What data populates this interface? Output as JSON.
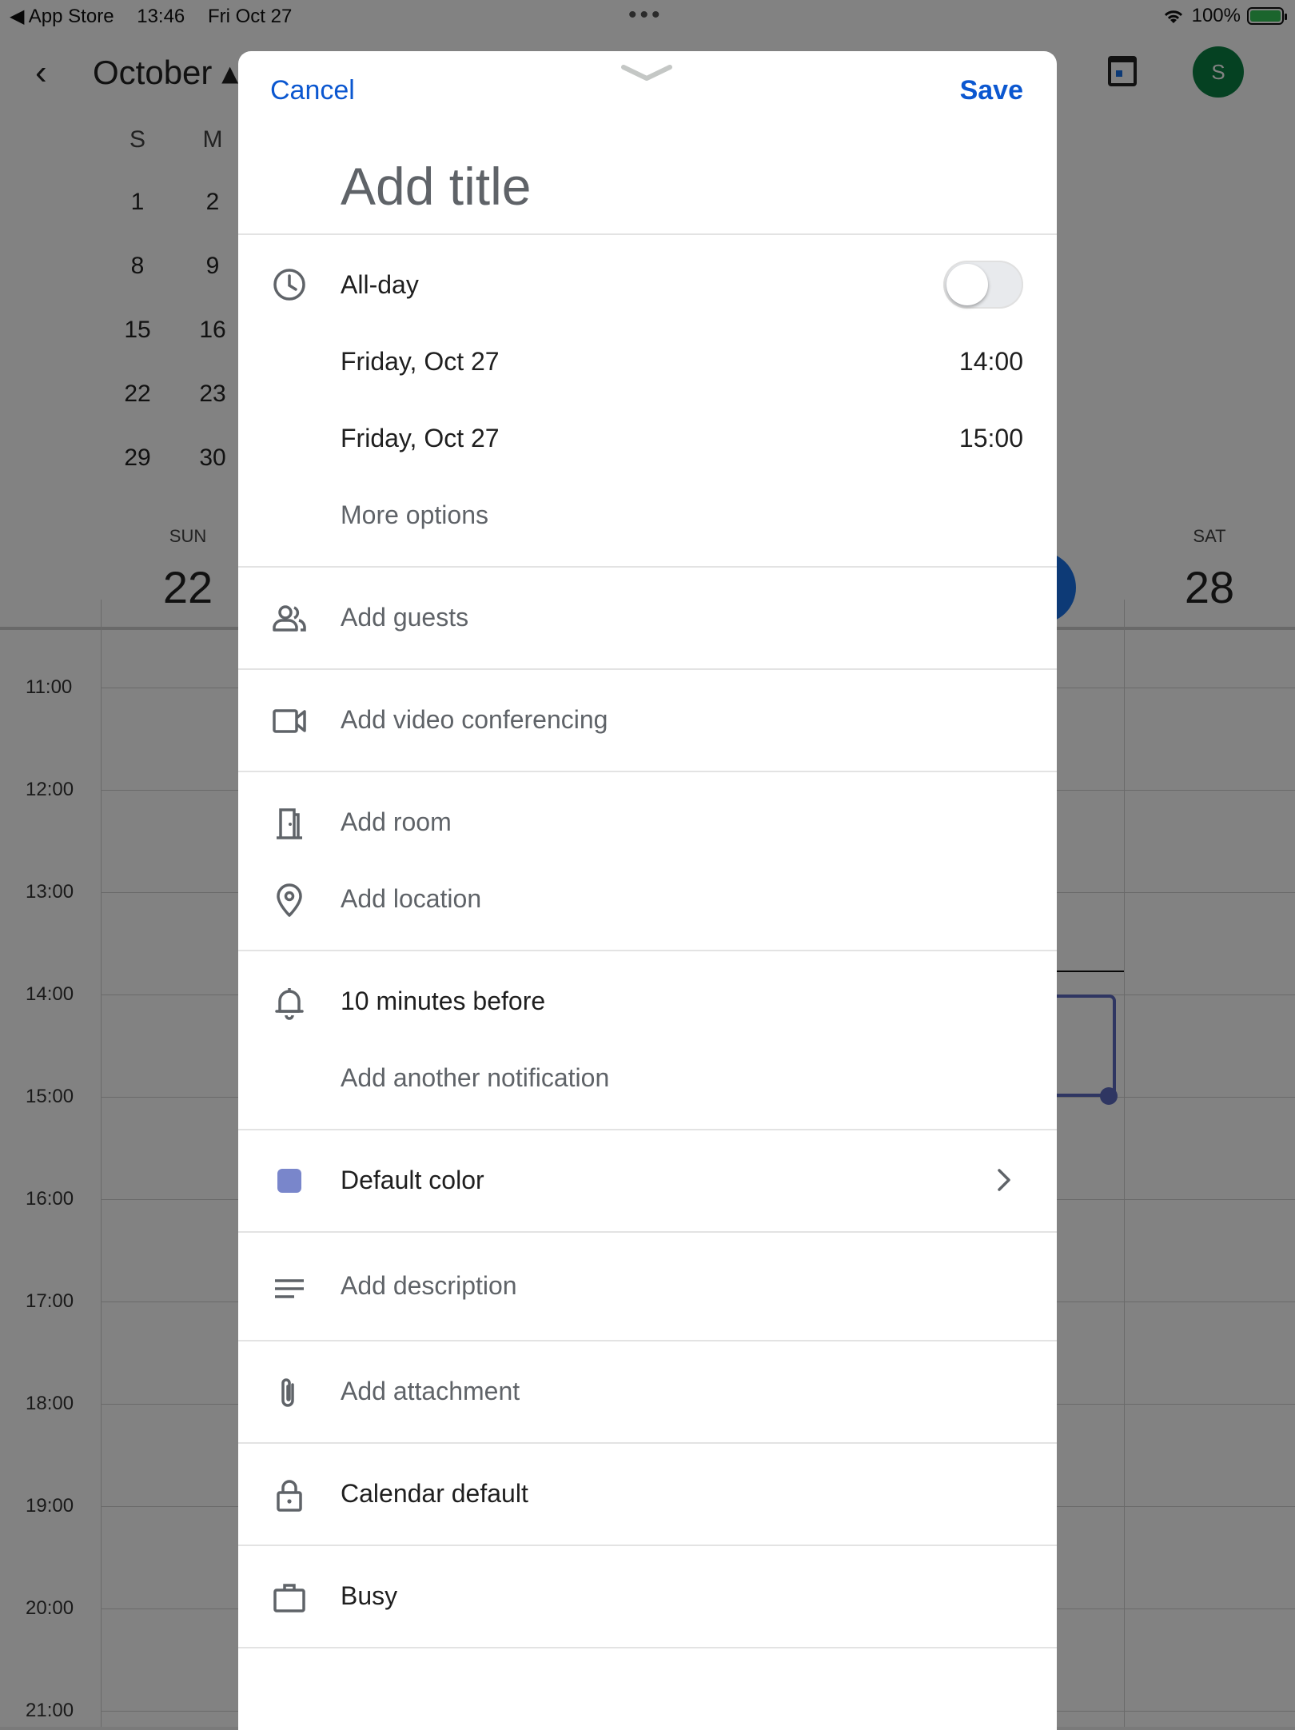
{
  "status_bar": {
    "back_app": "◀ App Store",
    "time": "13:46",
    "date": "Fri Oct 27",
    "battery": "100%"
  },
  "calendar_bg": {
    "month": "October",
    "avatar_initial": "S",
    "mini_cal_dow": [
      "S",
      "M"
    ],
    "mini_cal_rows": [
      [
        "1",
        "2"
      ],
      [
        "8",
        "9"
      ],
      [
        "15",
        "16"
      ],
      [
        "22",
        "23"
      ],
      [
        "29",
        "30"
      ]
    ],
    "week": [
      {
        "dow": "SUN",
        "day": "22"
      },
      {
        "dow": "SAT",
        "day": "28"
      }
    ],
    "hours": [
      "11:00",
      "12:00",
      "13:00",
      "14:00",
      "15:00",
      "16:00",
      "17:00",
      "18:00",
      "19:00",
      "20:00",
      "21:00"
    ],
    "accent_color": "#1a73e8",
    "event_color": "#5c6bc0"
  },
  "sheet": {
    "cancel_label": "Cancel",
    "save_label": "Save",
    "title_placeholder": "Add title",
    "all_day_label": "All-day",
    "all_day_on": false,
    "start_date": "Friday, Oct 27",
    "start_time": "14:00",
    "end_date": "Friday, Oct 27",
    "end_time": "15:00",
    "more_options": "More options",
    "add_guests": "Add guests",
    "add_video": "Add video conferencing",
    "add_room": "Add room",
    "add_location": "Add location",
    "notification": "10 minutes before",
    "add_notification": "Add another notification",
    "color_label": "Default color",
    "color_value": "#7986cb",
    "add_description": "Add description",
    "add_attachment": "Add attachment",
    "visibility": "Calendar default",
    "availability": "Busy",
    "link_color": "#0b57d0"
  }
}
